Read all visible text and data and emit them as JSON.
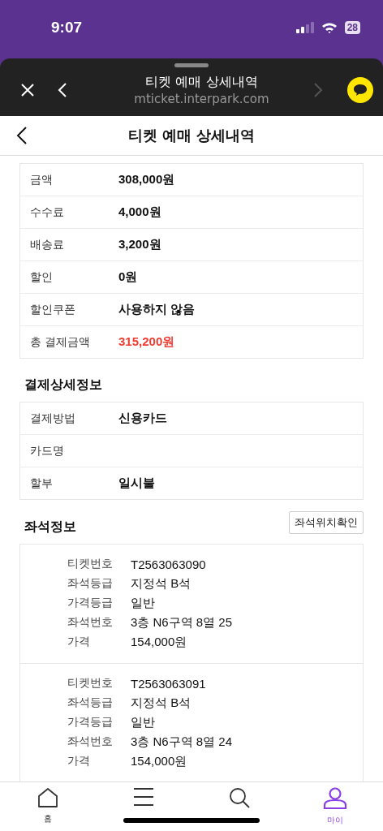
{
  "status_bar": {
    "time": "9:07",
    "battery": "28"
  },
  "browser": {
    "title": "티켓 예매 상세내역",
    "url": "mticket.interpark.com"
  },
  "header": {
    "title": "티켓 예매 상세내역"
  },
  "payment": {
    "rows": [
      {
        "label": "금액",
        "value": "308,000원",
        "highlight": false
      },
      {
        "label": "수수료",
        "value": "4,000원",
        "highlight": false
      },
      {
        "label": "배송료",
        "value": "3,200원",
        "highlight": false
      },
      {
        "label": "할인",
        "value": "0원",
        "highlight": false
      },
      {
        "label": "할인쿠폰",
        "value": "사용하지 않음",
        "highlight": false
      },
      {
        "label": "총 결제금액",
        "value": "315,200원",
        "highlight": true
      }
    ]
  },
  "payment_detail": {
    "title": "결제상세정보",
    "rows": [
      {
        "label": "결제방법",
        "value": "신용카드"
      },
      {
        "label": "카드명"
      },
      {
        "label": "할부",
        "value": "일시불"
      }
    ]
  },
  "seats": {
    "title": "좌석정보",
    "button": "좌석위치확인",
    "tickets": [
      {
        "rows": [
          {
            "label": "티켓번호",
            "value": "T2563063090"
          },
          {
            "label": "좌석등급",
            "value": "지정석 B석"
          },
          {
            "label": "가격등급",
            "value": "일반"
          },
          {
            "label": "좌석번호",
            "value": "3층 N6구역 8열 25"
          },
          {
            "label": "가격",
            "value": "154,000원"
          }
        ]
      },
      {
        "rows": [
          {
            "label": "티켓번호",
            "value": "T2563063091"
          },
          {
            "label": "좌석등급",
            "value": "지정석 B석"
          },
          {
            "label": "가격등급",
            "value": "일반"
          },
          {
            "label": "좌석번호",
            "value": "3층 N6구역 8열 24"
          },
          {
            "label": "가격",
            "value": "154,000원"
          }
        ]
      }
    ]
  },
  "tab_bar": [
    {
      "label": "홈",
      "kind": "home",
      "selected": false
    },
    {
      "kind": "menu",
      "selected": false
    },
    {
      "kind": "search",
      "selected": false
    },
    {
      "label": "마이",
      "kind": "person",
      "selected": true
    }
  ]
}
